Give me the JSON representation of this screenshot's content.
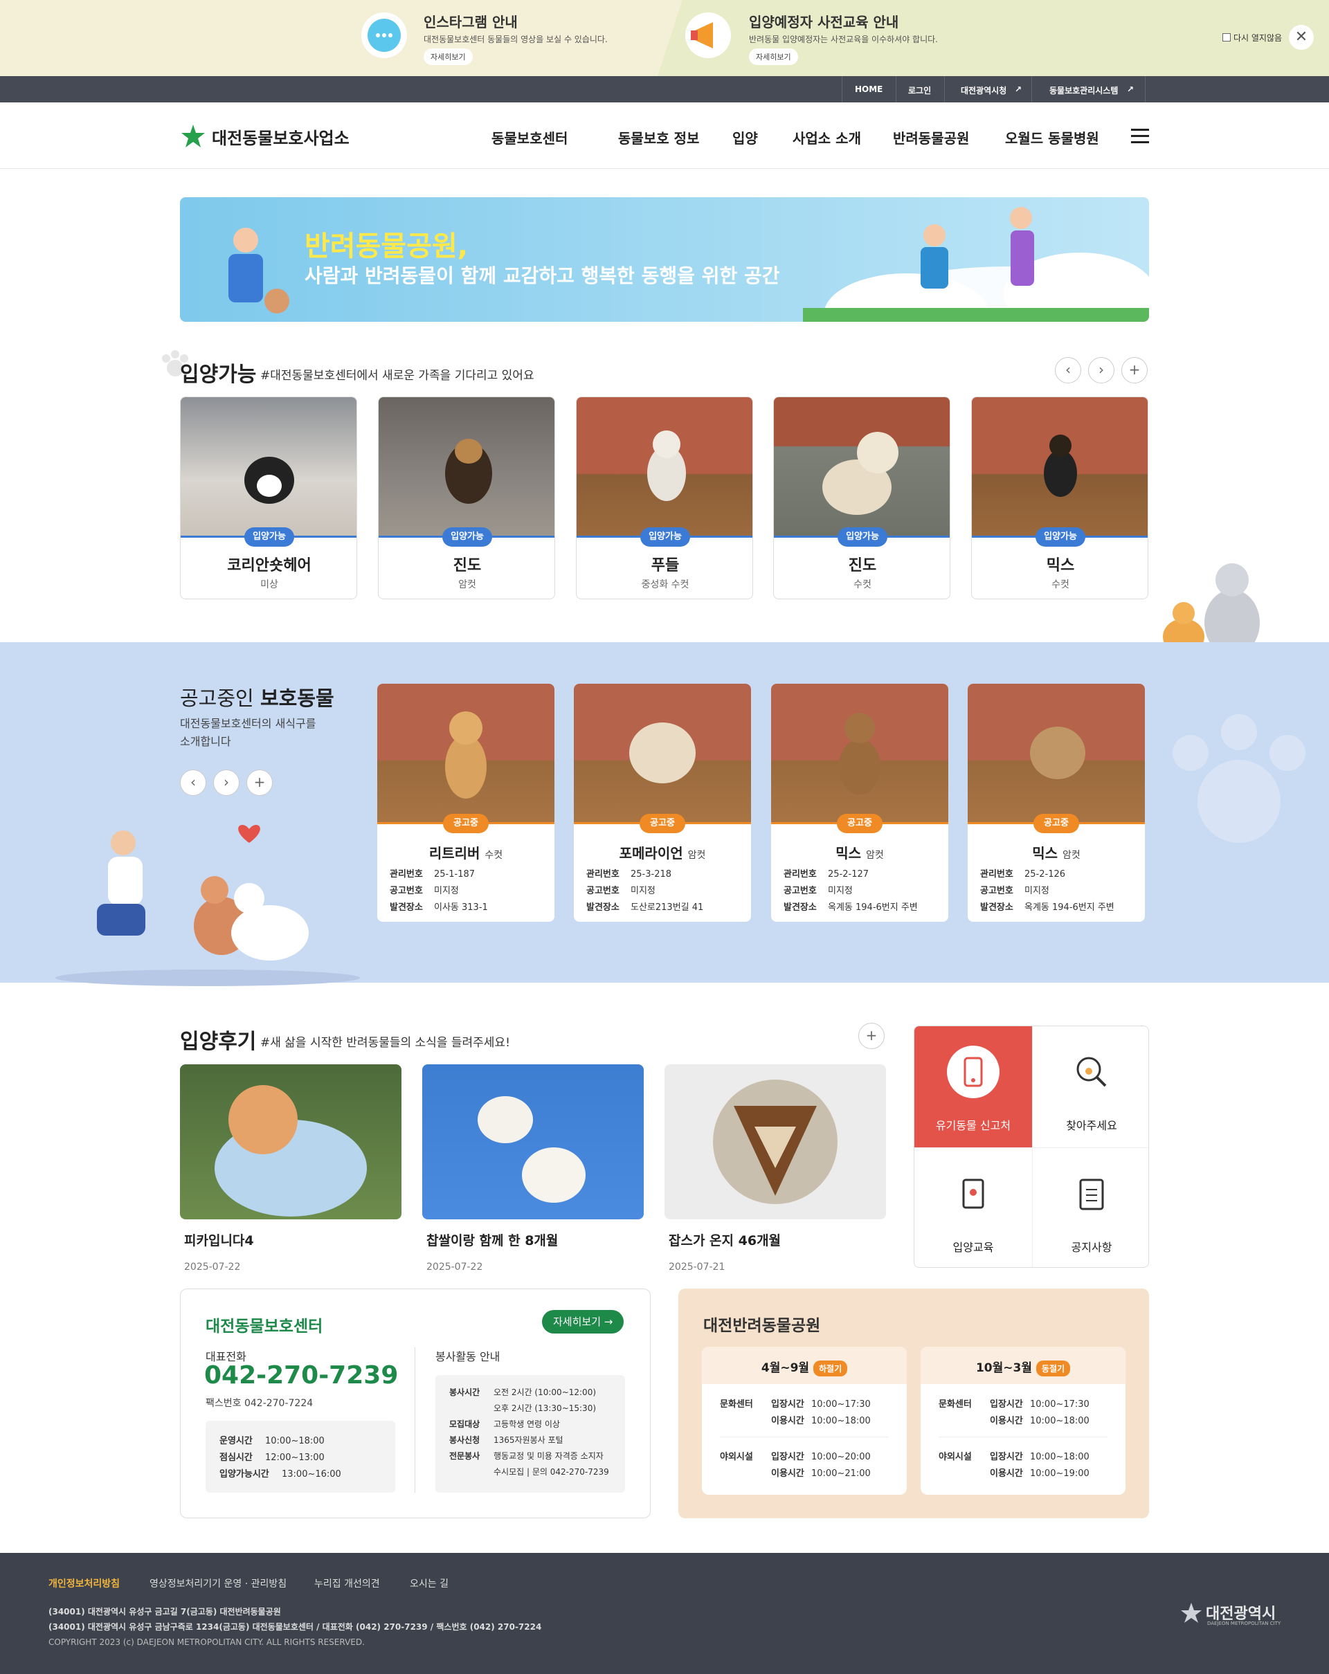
{
  "notice": {
    "left_title": "인스타그램 안내",
    "left_desc": "대전동물보호센터 동물들의 영상을 보실 수 있습니다.",
    "left_btn": "자세히보기",
    "right_title": "입양예정자 사전교육 안내",
    "right_desc": "반려동물 입양예정자는 사전교육을 이수하셔야 합니다.",
    "right_btn": "자세히보기",
    "dont_show": "다시 열지않음"
  },
  "util": {
    "home": "HOME",
    "login": "로그인",
    "city": "대전광역시청",
    "system": "동물보호관리시스템"
  },
  "gnb": {
    "logo": "대전동물보호사업소",
    "menus": [
      "동물보호센터",
      "동물보호 정보",
      "입양",
      "사업소 소개",
      "반려동물공원",
      "오월드 동물병원"
    ]
  },
  "banner": {
    "line1": "반려동물공원,",
    "line2": "사람과 반려동물이 함께 교감하고 행복한 동행을 위한 공간"
  },
  "adopt": {
    "title": "입양가능",
    "sub": "#대전동물보호센터에서 새로운 가족을 기다리고 있어요",
    "items": [
      {
        "badge": "입양가능",
        "name": "코리안숏헤어",
        "sex": "미상"
      },
      {
        "badge": "입양가능",
        "name": "진도",
        "sex": "암컷"
      },
      {
        "badge": "입양가능",
        "name": "푸들",
        "sex": "중성화 수컷"
      },
      {
        "badge": "입양가능",
        "name": "진도",
        "sex": "수컷"
      },
      {
        "badge": "입양가능",
        "name": "믹스",
        "sex": "수컷"
      }
    ]
  },
  "protect": {
    "title_light": "공고중인 ",
    "title_bold": "보호동물",
    "sub1": "대전동물보호센터의 새식구를",
    "sub2": "소개합니다",
    "label_no": "관리번호",
    "label_notice": "공고번호",
    "label_place": "발견장소",
    "items": [
      {
        "badge": "공고중",
        "name": "리트리버",
        "sex": "수컷",
        "no": "25-1-187",
        "notice": "미지정",
        "place": "이사동 313-1"
      },
      {
        "badge": "공고중",
        "name": "포메라이언",
        "sex": "암컷",
        "no": "25-3-218",
        "notice": "미지정",
        "place": "도산로213번길 41"
      },
      {
        "badge": "공고중",
        "name": "믹스",
        "sex": "암컷",
        "no": "25-2-127",
        "notice": "미지정",
        "place": "옥계동 194-6번지 주변"
      },
      {
        "badge": "공고중",
        "name": "믹스",
        "sex": "암컷",
        "no": "25-2-126",
        "notice": "미지정",
        "place": "옥계동 194-6번지 주변"
      }
    ]
  },
  "review": {
    "title": "입양후기",
    "sub": "#새 삶을 시작한 반려동물들의 소식을 들려주세요!",
    "items": [
      {
        "title": "피카입니다4",
        "date": "2025-07-22"
      },
      {
        "title": "찹쌀이랑 함께 한 8개월",
        "date": "2025-07-22"
      },
      {
        "title": "잡스가 온지 46개월",
        "date": "2025-07-21"
      }
    ]
  },
  "quick": {
    "items": [
      "유기동물 신고처",
      "찾아주세요",
      "입양교육",
      "공지사항"
    ]
  },
  "center": {
    "title": "대전동물보호센터",
    "more": "자세히보기",
    "phone_label": "대표전화",
    "phone": "042-270-7239",
    "fax": "팩스번호 042-270-7224",
    "hours": [
      {
        "k": "운영시간",
        "v": "10:00~18:00"
      },
      {
        "k": "점심시간",
        "v": "12:00~13:00"
      },
      {
        "k": "입양가능시간",
        "v": "13:00~16:00"
      }
    ],
    "volunteer_title": "봉사활동 안내",
    "volunteer": [
      {
        "k": "봉사시간",
        "v": "오전 2시간 (10:00~12:00)"
      },
      {
        "k": "",
        "v": "오후 2시간 (13:30~15:30)"
      },
      {
        "k": "모집대상",
        "v": "고등학생 연령 이상"
      },
      {
        "k": "봉사신청",
        "v": "1365자원봉사 포털"
      },
      {
        "k": "전문봉사",
        "v": "행동교정 및 미용 자격증 소지자"
      },
      {
        "k": "",
        "v": "수시모집 | 문의 042-270-7239"
      }
    ]
  },
  "park": {
    "title": "대전반려동물공원",
    "summer": {
      "period": "4월~9월",
      "tag": "하절기"
    },
    "winter": {
      "period": "10월~3월",
      "tag": "동절기"
    },
    "culture": "문화센터",
    "outdoor": "야외시설",
    "enter": "입장시간",
    "use": "이용시간",
    "summer_culture_enter": "10:00~17:30",
    "summer_culture_use": "10:00~18:00",
    "summer_outdoor_enter": "10:00~20:00",
    "summer_outdoor_use": "10:00~21:00",
    "winter_culture_enter": "10:00~17:30",
    "winter_culture_use": "10:00~18:00",
    "winter_outdoor_enter": "10:00~18:00",
    "winter_outdoor_use": "10:00~19:00"
  },
  "footer": {
    "links": [
      "개인정보처리방침",
      "영상정보처리기기 운영 · 관리방침",
      "누리집 개선의견",
      "오시는 길"
    ],
    "addr1": "(34001) 대전광역시 유성구 금고길 7(금고동) 대전반려동물공원",
    "addr2": "(34001) 대전광역시 유성구 금남구즉로 1234(금고동) 대전동물보호센터 / 대표전화 (042) 270-7239 / 팩스번호 (042) 270-7224",
    "copy": "COPYRIGHT 2023 (c) DAEJEON METROPOLITAN CITY. ALL RIGHTS RESERVED.",
    "logo": "대전광역시",
    "logo_en": "DAEJEON METROPOLITAN CITY"
  },
  "colors": {
    "blue": "#3b7bd6",
    "orange": "#f08a24",
    "green": "#1e8a4a",
    "red": "#e4534a"
  }
}
